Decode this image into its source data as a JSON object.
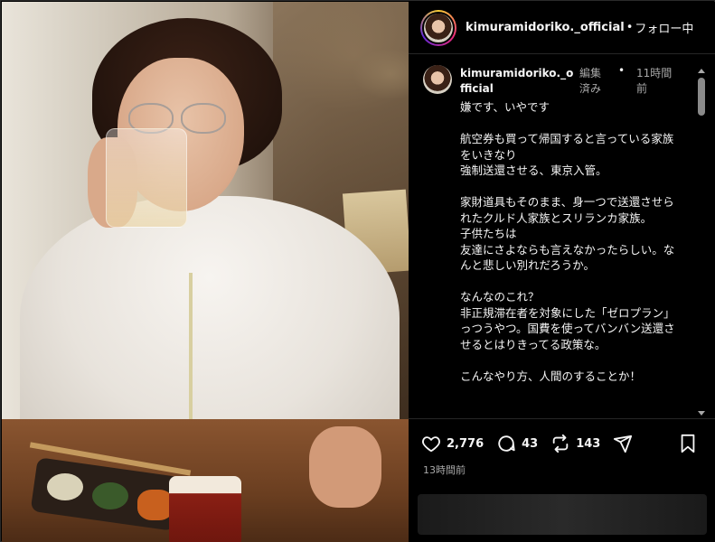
{
  "post": {
    "photo_alt": "",
    "header": {
      "username": "kimuramidoriko._official",
      "separator": "•",
      "follow_status": "フォロー中"
    },
    "caption": {
      "username": "kimuramidoriko._official",
      "edited_label": "編集済み",
      "dot": "•",
      "time": "11時間前",
      "text": "嫌です、いやです\n\n航空券も買って帰国すると言っている家族をいきなり\n強制送還させる、東京入管。\n\n家財道具もそのまま、身一つで送還させられたクルド人家族とスリランカ家族。\n子供たちは\n友達にさよならも言えなかったらしい。なんと悲しい別れだろうか。\n\nなんなのこれ？\n非正規滞在者を対象にした「ゼロプラン」っつうやつ。国費を使ってバンバン送還させるとはりきってる政策な。\n\nこんなやり方、人間のすることか！"
    },
    "actions": {
      "likes": "2,776",
      "comments": "43",
      "reposts": "143"
    },
    "timestamp": "13時間前"
  },
  "icons": [
    "heart-icon",
    "comment-icon",
    "repost-icon",
    "share-icon",
    "bookmark-icon"
  ],
  "colors": {
    "background": "#000000",
    "text": "#f5f5f5",
    "muted": "#a8a8a8",
    "divider": "#262626"
  }
}
